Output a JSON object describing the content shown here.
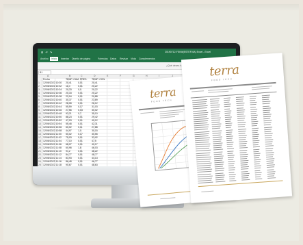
{
  "excel": {
    "quick_access": "⊞ ↶ ↷",
    "file_title": "20190712-FSKM(ESTER 6A) Excel - Excel",
    "tabs": [
      "Archivo",
      "Inicio",
      "Insertar",
      "Diseño de página",
      "Fórmulas",
      "Datos",
      "Revisar",
      "Vista",
      "Complementos"
    ],
    "tell_me": "¿Qué desea hacer?",
    "name_box": "B1",
    "col_letters": [
      "A",
      "B",
      "C",
      "D",
      "E",
      "F",
      "G",
      "H",
      "I",
      "J",
      "K",
      "L",
      "M",
      "N",
      "O"
    ],
    "header": {
      "a": "Fecha",
      "b": "TEMP. CAM. PRES.",
      "c": "TEMP. CON."
    },
    "rows": [
      [
        "1",
        "12/06/2022 10:30",
        "20,41",
        "0,01",
        "20,41"
      ],
      [
        "2",
        "12/06/2022 10:32",
        "11,0",
        "0,01",
        "20,22"
      ],
      [
        "3",
        "12/06/2022 10:34",
        "20,33",
        "0,0",
        "20,22"
      ],
      [
        "4",
        "12/06/2022 10:36",
        "20,33",
        "0,01",
        "20,22"
      ],
      [
        "5",
        "12/06/2022 10:38",
        "22,04",
        "0,01",
        "20,88"
      ],
      [
        "6",
        "12/06/2022 10:40",
        "30,37",
        "0,01",
        "23,89"
      ],
      [
        "7",
        "12/06/2022 10:42",
        "28,08",
        "0,01",
        "26,12"
      ],
      [
        "8",
        "12/06/2022 10:44",
        "55,59",
        "0,17",
        "31,03"
      ],
      [
        "9",
        "12/06/2022 10:46",
        "27,56",
        "0,03",
        "30,02"
      ],
      [
        "10",
        "12/06/2022 10:48",
        "93,21",
        "0,7",
        "35,10"
      ],
      [
        "11",
        "12/06/2022 10:50",
        "88,23",
        "0,01",
        "29,42"
      ],
      [
        "12",
        "12/06/2022 10:52",
        "47,03",
        "0,01",
        "40,12"
      ],
      [
        "13",
        "12/06/2022 10:54",
        "55,48",
        "0,01",
        "42,31"
      ],
      [
        "14",
        "12/06/2022 10:56",
        "60,02",
        "0,11",
        "27,88"
      ],
      [
        "15",
        "12/06/2022 10:58",
        "44,97",
        "1,0",
        "30,15"
      ],
      [
        "16",
        "12/06/2022 11:00",
        "50,02",
        "0,17",
        "30,55"
      ],
      [
        "17",
        "12/06/2022 11:02",
        "75,03",
        "0,01",
        "33,92"
      ],
      [
        "18",
        "12/06/2022 11:04",
        "77,10",
        "0,01",
        "47,5"
      ],
      [
        "19",
        "12/06/2022 11:06",
        "68,07",
        "0,01",
        "40,17"
      ],
      [
        "20",
        "12/06/2022 11:08",
        "60,98",
        "1,8",
        "46,03"
      ],
      [
        "21",
        "12/06/2022 11:10",
        "91,2",
        "0,01",
        "48,22"
      ],
      [
        "22",
        "12/06/2022 11:12",
        "84,77",
        "0,01",
        "48,77"
      ],
      [
        "23",
        "12/06/2022 11:14",
        "83,93",
        "0,01",
        "44,13"
      ],
      [
        "24",
        "12/06/2022 11:16",
        "86,48",
        "0,01",
        "46,77"
      ],
      [
        "25",
        "12/06/2022 11:18",
        "90,67",
        "0,01",
        "48,63"
      ],
      [
        "26",
        "12/06/2022 11:20",
        "100,8",
        "0,01",
        "48,77"
      ],
      [
        "27",
        "12/06/2022 11:22",
        "110,63",
        "0,8",
        "47,11"
      ]
    ]
  },
  "report_front": {
    "logo_main": "terra",
    "logo_sub": "FOOD TECH"
  },
  "report_back": {
    "logo_main": "terra",
    "logo_sub": "FOOD TECH"
  }
}
